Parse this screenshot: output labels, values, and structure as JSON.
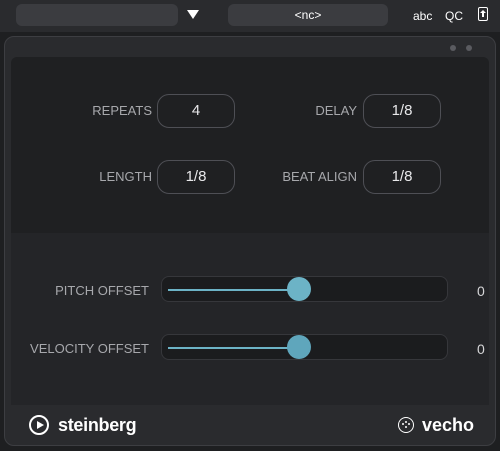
{
  "toolbar": {
    "preset_value": "",
    "midi_input": "<nc>",
    "abc_label": "abc",
    "qc_label": "QC"
  },
  "params": {
    "repeats": {
      "label": "REPEATS",
      "value": "4"
    },
    "delay": {
      "label": "DELAY",
      "value": "1/8"
    },
    "length": {
      "label": "LENGTH",
      "value": "1/8"
    },
    "beat_align": {
      "label": "BEAT ALIGN",
      "value": "1/8"
    }
  },
  "sliders": {
    "pitch_offset": {
      "label": "PITCH OFFSET",
      "value": "0",
      "level": 0.5
    },
    "velocity_offset": {
      "label": "VELOCITY OFFSET",
      "value": "0",
      "level": 0.5
    }
  },
  "footer": {
    "brand": "steinberg",
    "plugin_name": "vecho"
  },
  "colors": {
    "accent": "#5fa6bc",
    "background": "#2a2b2e",
    "panel": "#1f2022"
  }
}
